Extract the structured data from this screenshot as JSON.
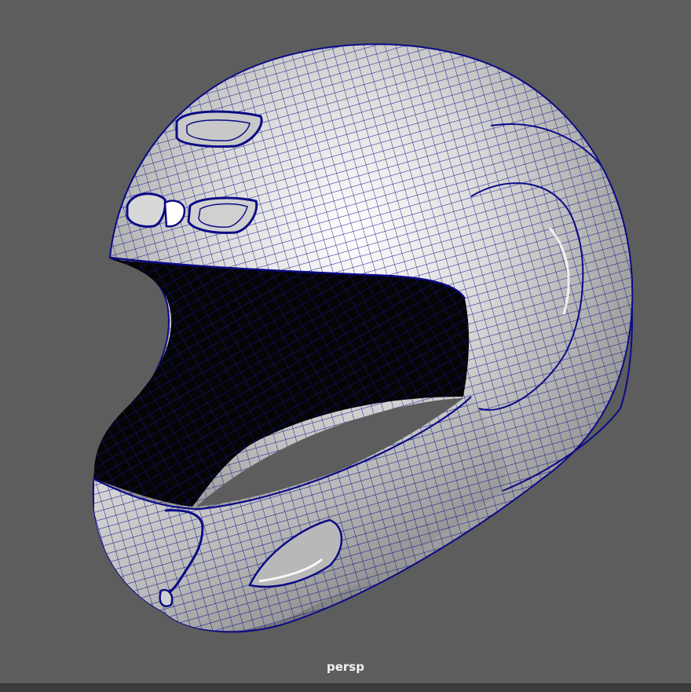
{
  "viewport": {
    "camera_name": "persp",
    "background_color": "#5d5d5d",
    "wireframe_color": "#0a0a80",
    "object": "helmet-mesh"
  }
}
